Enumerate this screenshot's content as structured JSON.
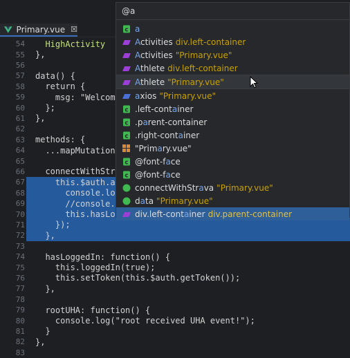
{
  "tab": {
    "label": "Primary.vue",
    "close": "☒"
  },
  "search": {
    "value": "@a"
  },
  "editor": {
    "lines": [
      {
        "num": "54",
        "code": "  HighActivity",
        "color": "t-green"
      },
      {
        "num": "55",
        "code": "},",
        "color": "t-white"
      },
      {
        "num": "56",
        "code": "",
        "color": "t-white"
      },
      {
        "num": "57",
        "code": "data() {",
        "color": "t-white"
      },
      {
        "num": "58",
        "code": "  return {",
        "color": "t-white"
      },
      {
        "num": "59",
        "code": "    msg: \"Welcome",
        "color": "t-white"
      },
      {
        "num": "60",
        "code": "  };",
        "color": "t-white"
      },
      {
        "num": "61",
        "code": "},",
        "color": "t-white"
      },
      {
        "num": "62",
        "code": "",
        "color": "t-white"
      },
      {
        "num": "63",
        "code": "methods: {",
        "color": "t-white"
      },
      {
        "num": "64",
        "code": "  ...mapMutations",
        "color": "t-white"
      },
      {
        "num": "65",
        "code": "",
        "color": "t-white"
      },
      {
        "num": "66",
        "code": "  connectWithStra",
        "color": "t-white"
      },
      {
        "num": "67",
        "code": "    this.$auth.au",
        "color": "t-white",
        "sel": true
      },
      {
        "num": "68",
        "code": "      console.log",
        "color": "t-white",
        "sel": true
      },
      {
        "num": "69",
        "code": "      //console.l",
        "color": "t-white",
        "sel": true
      },
      {
        "num": "70",
        "code": "      this.hasLog",
        "color": "t-white",
        "sel": true
      },
      {
        "num": "71",
        "code": "    });",
        "color": "t-white",
        "sel": true
      },
      {
        "num": "72",
        "code": "  },",
        "color": "t-white",
        "sel": true
      },
      {
        "num": "73",
        "code": "",
        "color": "t-white"
      },
      {
        "num": "74",
        "code": "  hasLoggedIn: function() {",
        "color": "t-white"
      },
      {
        "num": "75",
        "code": "    this.loggedIn(true);",
        "color": "t-white"
      },
      {
        "num": "76",
        "code": "    this.setToken(this.$auth.getToken());",
        "color": "t-white"
      },
      {
        "num": "77",
        "code": "  },",
        "color": "t-white"
      },
      {
        "num": "78",
        "code": "",
        "color": "t-white"
      },
      {
        "num": "79",
        "code": "  rootUHA: function() {",
        "color": "t-white"
      },
      {
        "num": "80",
        "code": "    console.log(\"root received UHA event!\");",
        "color": "t-white"
      },
      {
        "num": "81",
        "code": "  }",
        "color": "t-white"
      },
      {
        "num": "82",
        "code": "},",
        "color": "t-white"
      },
      {
        "num": "83",
        "code": "",
        "color": "t-white"
      }
    ]
  },
  "results": [
    {
      "icon": "vue-icon",
      "pre": "",
      "hl": "a",
      "post": "",
      "ctx": "",
      "state": "",
      "sepAfter": false
    },
    {
      "icon": "purple-tag-icon",
      "pre": "",
      "hl": "A",
      "post": "ctivities",
      "ctx": "div.left-container",
      "state": "",
      "sepAfter": false
    },
    {
      "icon": "purple-tag-icon",
      "pre": "",
      "hl": "A",
      "post": "ctivities",
      "ctx": "\"Primary.vue\"",
      "state": "",
      "sepAfter": false
    },
    {
      "icon": "purple-tag-icon",
      "pre": "",
      "hl": "A",
      "post": "thlete",
      "ctx": "div.left-container",
      "state": "",
      "sepAfter": true
    },
    {
      "icon": "purple-tag-icon",
      "pre": "",
      "hl": "A",
      "post": "thlete",
      "ctx": "\"Primary.vue\"",
      "state": "hover",
      "sepAfter": true
    },
    {
      "icon": "blue-tag-icon",
      "pre": "",
      "hl": "a",
      "post": "xios",
      "ctx": "\"Primary.vue\"",
      "state": "",
      "sepAfter": false
    },
    {
      "icon": "css-icon",
      "pre": ".left-cont",
      "hl": "a",
      "post": "iner",
      "ctx": "",
      "state": "",
      "sepAfter": false
    },
    {
      "icon": "css-icon",
      "pre": ".p",
      "hl": "a",
      "post": "rent-container",
      "ctx": "",
      "state": "",
      "sepAfter": false
    },
    {
      "icon": "css-icon",
      "pre": ".right-cont",
      "hl": "a",
      "post": "iner",
      "ctx": "",
      "state": "",
      "sepAfter": false
    },
    {
      "icon": "grid-icon",
      "pre": "\"Prim",
      "hl": "a",
      "post": "ry.vue\"",
      "ctx": "",
      "state": "",
      "sepAfter": false
    },
    {
      "icon": "css-icon",
      "pre": "@font-f",
      "hl": "a",
      "post": "ce",
      "ctx": "",
      "state": "",
      "sepAfter": false
    },
    {
      "icon": "css-icon",
      "pre": "@font-f",
      "hl": "a",
      "post": "ce",
      "ctx": "",
      "state": "",
      "sepAfter": false
    },
    {
      "icon": "green-dot-icon",
      "pre": "connectWithStr",
      "hl": "a",
      "post": "va",
      "ctx": "\"Primary.vue\"",
      "state": "",
      "sepAfter": false
    },
    {
      "icon": "green-dot-icon",
      "pre": "d",
      "hl": "a",
      "post": "ta",
      "ctx": "\"Primary.vue\"",
      "state": "",
      "sepAfter": false
    },
    {
      "icon": "purple-tag-icon",
      "pre": "div.left-cont",
      "hl": "a",
      "post": "iner",
      "ctx": "div.parent-container",
      "state": "active",
      "sepAfter": false
    }
  ]
}
